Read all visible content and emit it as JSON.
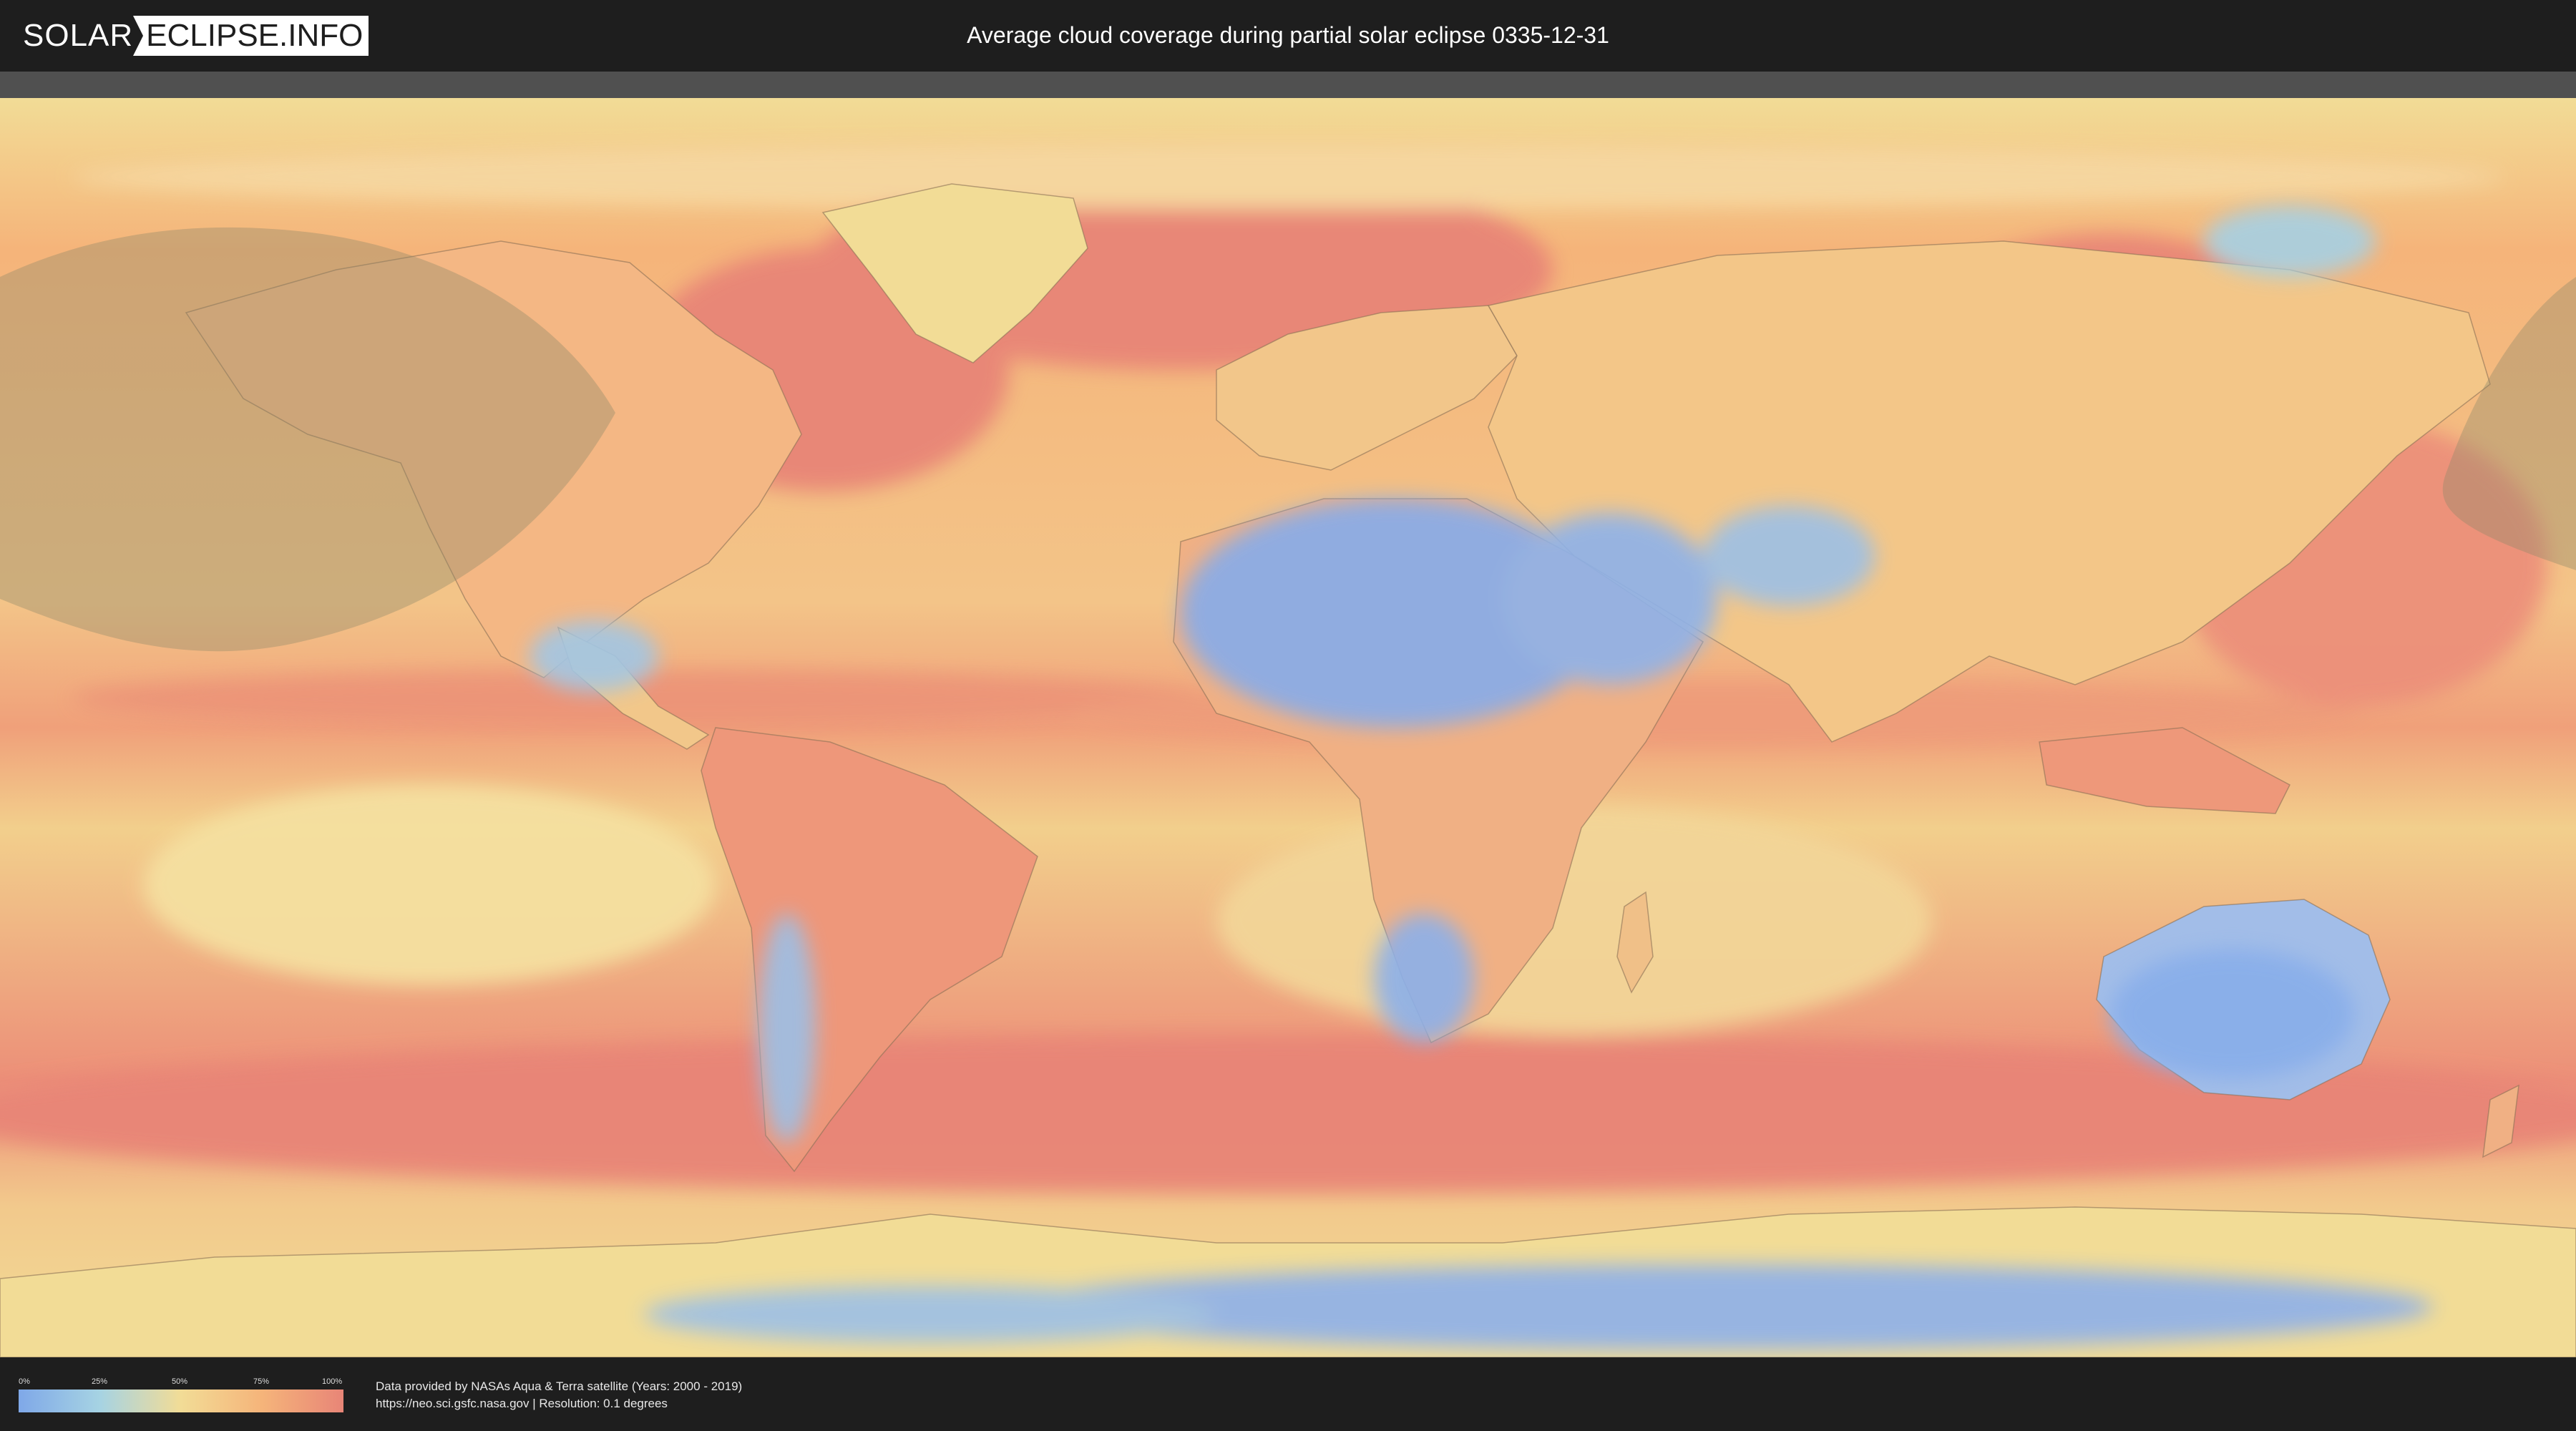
{
  "header": {
    "logo_left": "SOLAR",
    "logo_right": "ECLIPSE.INFO",
    "title": "Average cloud coverage during partial solar eclipse 0335-12-31"
  },
  "map": {
    "description_colors": {
      "clear": "#7fa8e8",
      "low": "#a6d3e3",
      "mid": "#f2dc96",
      "high": "#f5b47a",
      "overcast": "#e88577",
      "eclipse_shadow": "#8e8a6a"
    }
  },
  "legend": {
    "ticks": [
      "0%",
      "25%",
      "50%",
      "75%",
      "100%"
    ],
    "gradient": [
      "#7fa8e8",
      "#a6d3e3",
      "#f2dc96",
      "#f5b47a",
      "#e88577"
    ]
  },
  "footer": {
    "line1": "Data provided by NASAs Aqua & Terra satellite (Years: 2000 - 2019)",
    "line2": "https://neo.sci.gsfc.nasa.gov | Resolution: 0.1 degrees"
  }
}
